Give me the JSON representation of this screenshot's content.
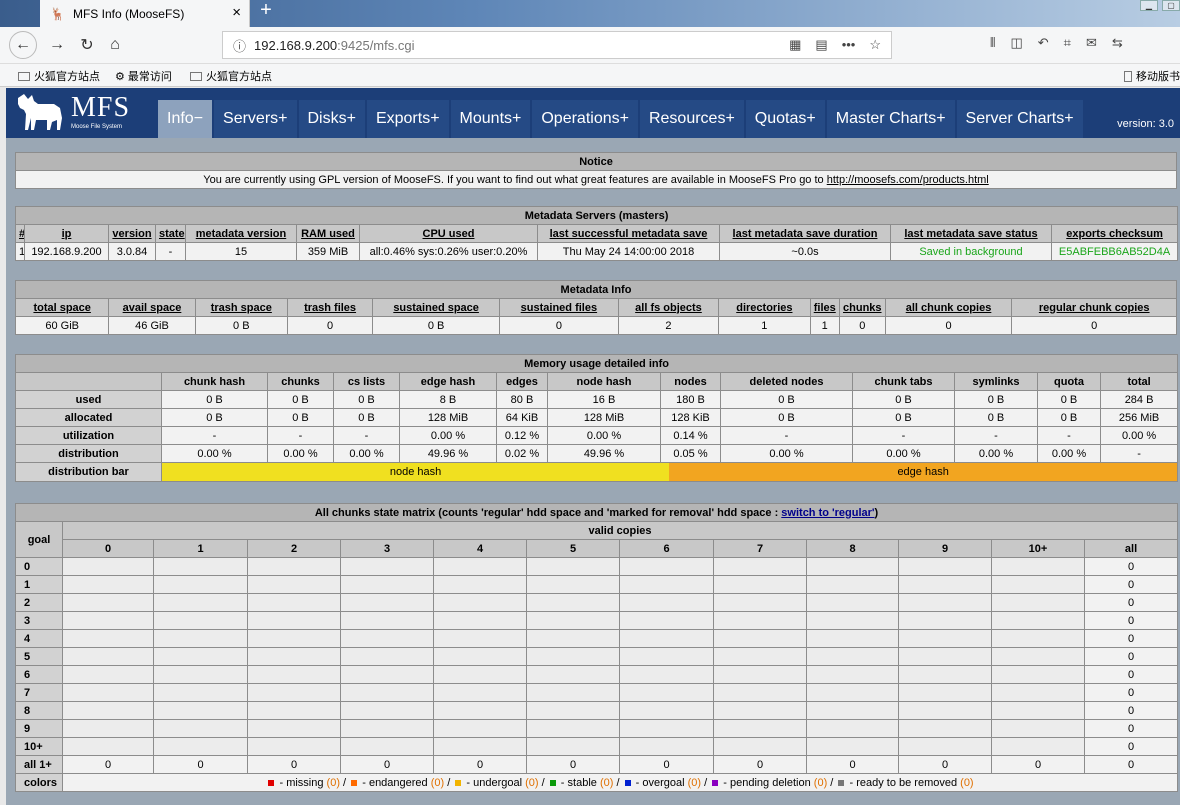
{
  "browser": {
    "tab_title": "MFS Info (MooseFS)",
    "close_glyph": "×",
    "new_tab_glyph": "+",
    "url_host": "192.168.9.200",
    "url_rest": ":9425/mfs.cgi",
    "bookmarks": [
      "火狐官方站点",
      "最常访问",
      "火狐官方站点"
    ],
    "mobile_bookmarks": "移动版书"
  },
  "mfs": {
    "logo_text": "MFS",
    "logo_sub": "Moose File System",
    "menu": [
      "Info",
      "Servers",
      "Disks",
      "Exports",
      "Mounts",
      "Operations",
      "Resources",
      "Quotas",
      "Master Charts",
      "Server Charts"
    ],
    "menu_suffix_active": " −",
    "menu_suffix": " +",
    "version": "version: 3.0"
  },
  "notice": {
    "title": "Notice",
    "text": "You are currently using GPL version of MooseFS. If you want to find out what great features are available in MooseFS Pro go to ",
    "link": "http://moosefs.com/products.html"
  },
  "masters": {
    "title": "Metadata Servers (masters)",
    "headers": [
      "#",
      "ip",
      "version",
      "state",
      "metadata version",
      "RAM used",
      "CPU used",
      "last successful metadata save",
      "last metadata save duration",
      "last metadata save status",
      "exports checksum"
    ],
    "row": [
      "1",
      "192.168.9.200",
      "3.0.84",
      "-",
      "15",
      "359 MiB",
      "all:0.46% sys:0.26% user:0.20%",
      "Thu May 24 14:00:00 2018",
      "~0.0s",
      "Saved in background",
      "E5ABFEBB6AB52D4A"
    ]
  },
  "metainfo": {
    "title": "Metadata Info",
    "headers": [
      "total space",
      "avail space",
      "trash space",
      "trash files",
      "sustained space",
      "sustained files",
      "all fs objects",
      "directories",
      "files",
      "chunks",
      "all chunk copies",
      "regular chunk copies"
    ],
    "row": [
      "60 GiB",
      "46 GiB",
      "0 B",
      "0",
      "0 B",
      "0",
      "2",
      "1",
      "1",
      "0",
      "0",
      "0"
    ]
  },
  "memory": {
    "title": "Memory usage detailed info",
    "headers": [
      "chunk hash",
      "chunks",
      "cs lists",
      "edge hash",
      "edges",
      "node hash",
      "nodes",
      "deleted nodes",
      "chunk tabs",
      "symlinks",
      "quota",
      "total"
    ],
    "rows": [
      {
        "label": "used",
        "cells": [
          "0 B",
          "0 B",
          "0 B",
          "8 B",
          "80 B",
          "16 B",
          "180 B",
          "0 B",
          "0 B",
          "0 B",
          "0 B",
          "284 B"
        ]
      },
      {
        "label": "allocated",
        "cells": [
          "0 B",
          "0 B",
          "0 B",
          "128 MiB",
          "64 KiB",
          "128 MiB",
          "128 KiB",
          "0 B",
          "0 B",
          "0 B",
          "0 B",
          "256 MiB"
        ]
      },
      {
        "label": "utilization",
        "cells": [
          "-",
          "-",
          "-",
          "0.00 %",
          "0.12 %",
          "0.00 %",
          "0.14 %",
          "-",
          "-",
          "-",
          "-",
          "0.00 %"
        ]
      },
      {
        "label": "distribution",
        "cells": [
          "0.00 %",
          "0.00 %",
          "0.00 %",
          "49.96 %",
          "0.02 %",
          "49.96 %",
          "0.05 %",
          "0.00 %",
          "0.00 %",
          "0.00 %",
          "0.00 %",
          "-"
        ]
      }
    ],
    "bar_label": "distribution bar",
    "bar": [
      {
        "name": "node hash",
        "share": 0.4996,
        "color": "#f0e020"
      },
      {
        "name": "edge hash",
        "share": 0.5004,
        "color": "#f2a520"
      }
    ]
  },
  "matrix": {
    "title_pre": "All chunks state matrix (counts 'regular' hdd space and 'marked for removal' hdd space : ",
    "title_link": "switch to 'regular'",
    "title_post": ")",
    "goal_label": "goal",
    "valid_label": "valid copies",
    "cols": [
      "0",
      "1",
      "2",
      "3",
      "4",
      "5",
      "6",
      "7",
      "8",
      "9",
      "10+",
      "all"
    ],
    "rows": [
      "0",
      "1",
      "2",
      "3",
      "4",
      "5",
      "6",
      "7",
      "8",
      "9",
      "10+"
    ],
    "all_label": "all 1+",
    "all_value": "0",
    "colors_label": "colors",
    "legend": [
      {
        "color": "#e00000",
        "text": " - missing ",
        "count": "(0)",
        "sep": " / "
      },
      {
        "color": "#ff6a00",
        "text": " - endangered ",
        "count": "(0)",
        "sep": " / "
      },
      {
        "color": "#f2b400",
        "text": " - undergoal ",
        "count": "(0)",
        "sep": " / "
      },
      {
        "color": "#0a9a0a",
        "text": " - stable ",
        "count": "(0)",
        "sep": " / "
      },
      {
        "color": "#0020d0",
        "text": " - overgoal ",
        "count": "(0)",
        "sep": " / "
      },
      {
        "color": "#8a00c0",
        "text": " - pending deletion ",
        "count": "(0)",
        "sep": " / "
      },
      {
        "color": "#777777",
        "text": " - ready to be removed ",
        "count": "(0)",
        "sep": ""
      }
    ]
  }
}
